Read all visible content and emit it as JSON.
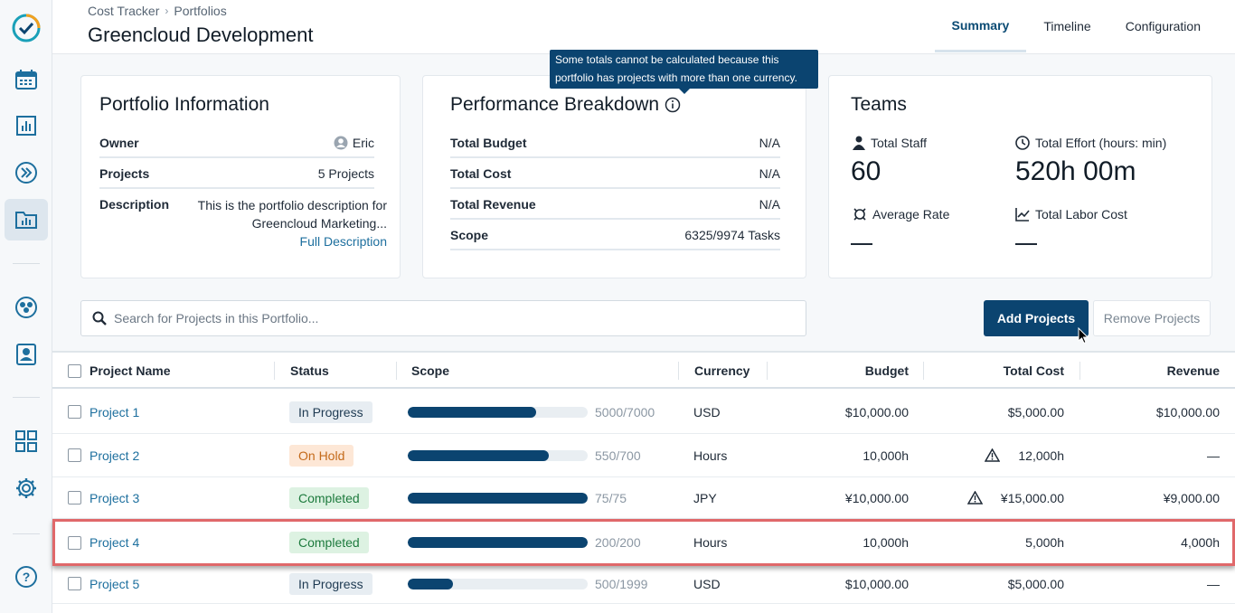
{
  "breadcrumb": {
    "root": "Cost Tracker",
    "current": "Portfolios"
  },
  "page_title": "Greencloud Development",
  "tabs": [
    {
      "label": "Summary",
      "active": true
    },
    {
      "label": "Timeline",
      "active": false
    },
    {
      "label": "Configuration",
      "active": false
    }
  ],
  "sidebar": {
    "items": [
      {
        "icon": "logo-check-icon"
      },
      {
        "icon": "calendar-icon"
      },
      {
        "icon": "bar-chart-icon"
      },
      {
        "icon": "fast-forward-icon"
      },
      {
        "icon": "folder-chart-icon",
        "active": true
      },
      {
        "icon": "team-icon"
      },
      {
        "icon": "contact-card-icon"
      },
      {
        "icon": "grid-apps-icon"
      },
      {
        "icon": "gear-icon"
      },
      {
        "icon": "help-icon"
      }
    ]
  },
  "portfolio_info": {
    "title": "Portfolio Information",
    "owner_label": "Owner",
    "owner_value": "Eric",
    "projects_label": "Projects",
    "projects_value": "5 Projects",
    "description_label": "Description",
    "description_value": "This is the portfolio description for Greencloud Marketing...",
    "full_description_link": "Full Description"
  },
  "performance": {
    "title": "Performance Breakdown",
    "tooltip": "Some totals cannot be calculated because this portfolio has projects with more than one currency.",
    "rows": [
      {
        "label": "Total Budget",
        "value": "N/A"
      },
      {
        "label": "Total Cost",
        "value": "N/A"
      },
      {
        "label": "Total Revenue",
        "value": "N/A"
      },
      {
        "label": "Scope",
        "value": "6325/9974 Tasks"
      }
    ]
  },
  "teams": {
    "title": "Teams",
    "total_staff_label": "Total Staff",
    "total_staff_value": "60",
    "total_effort_label": "Total Effort (hours: min)",
    "total_effort_value": "520h 00m",
    "average_rate_label": "Average Rate",
    "total_labor_cost_label": "Total Labor Cost"
  },
  "search": {
    "placeholder": "Search for Projects in this Portfolio..."
  },
  "actions": {
    "add_label": "Add Projects",
    "remove_label": "Remove Projects"
  },
  "table": {
    "headers": {
      "name": "Project Name",
      "status": "Status",
      "scope": "Scope",
      "currency": "Currency",
      "budget": "Budget",
      "total_cost": "Total Cost",
      "revenue": "Revenue"
    },
    "rows": [
      {
        "name": "Project 1",
        "status": "In Progress",
        "status_kind": "progress",
        "scope_done": 5000,
        "scope_total": 7000,
        "scope_text": "5000/7000",
        "currency": "USD",
        "budget": "$10,000.00",
        "total_cost": "$5,000.00",
        "cost_warning": false,
        "revenue": "$10,000.00"
      },
      {
        "name": "Project 2",
        "status": "On Hold",
        "status_kind": "hold",
        "scope_done": 550,
        "scope_total": 700,
        "scope_text": "550/700",
        "currency": "Hours",
        "budget": "10,000h",
        "total_cost": "12,000h",
        "cost_warning": true,
        "revenue": "—"
      },
      {
        "name": "Project 3",
        "status": "Completed",
        "status_kind": "done",
        "scope_done": 75,
        "scope_total": 75,
        "scope_text": "75/75",
        "currency": "JPY",
        "budget": "¥10,000.00",
        "total_cost": "¥15,000.00",
        "cost_warning": true,
        "revenue": "¥9,000.00"
      },
      {
        "name": "Project 4",
        "status": "Completed",
        "status_kind": "done",
        "scope_done": 200,
        "scope_total": 200,
        "scope_text": "200/200",
        "currency": "Hours",
        "budget": "10,000h",
        "total_cost": "5,000h",
        "cost_warning": false,
        "revenue": "4,000h",
        "highlighted": true
      },
      {
        "name": "Project 5",
        "status": "In Progress",
        "status_kind": "progress",
        "scope_done": 500,
        "scope_total": 1999,
        "scope_text": "500/1999",
        "currency": "USD",
        "budget": "$10,000.00",
        "total_cost": "$5,000.00",
        "cost_warning": false,
        "revenue": "—"
      }
    ]
  },
  "colors": {
    "primary": "#0b4470",
    "link": "#1d6f9e",
    "highlight_border": "#e0686a"
  }
}
